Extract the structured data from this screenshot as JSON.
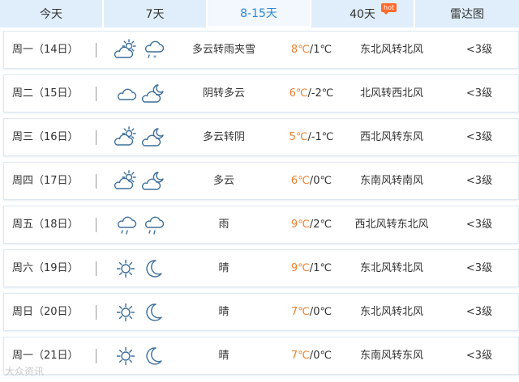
{
  "tabs": [
    {
      "label": "今天"
    },
    {
      "label": "7天"
    },
    {
      "label": "8-15天"
    },
    {
      "label": "40天",
      "badge": "hot"
    },
    {
      "label": "雷达图"
    }
  ],
  "active_tab": "8-15天",
  "accent_color": "#2b8ad8",
  "high_temp_color": "#f0812f",
  "rows": [
    {
      "day": "周一（14日）",
      "icon_day": "partly-cloudy-day-icon",
      "icon_night": "sleet-icon",
      "desc": "多云转雨夹雪",
      "high": "8℃",
      "low": "1℃",
      "wind": "东北风转北风",
      "level": "<3级"
    },
    {
      "day": "周二（15日）",
      "icon_day": "overcast-icon",
      "icon_night": "partly-cloudy-night-icon",
      "desc": "阴转多云",
      "high": "6℃",
      "low": "-2℃",
      "wind": "北风转西北风",
      "level": "<3级"
    },
    {
      "day": "周三（16日）",
      "icon_day": "partly-cloudy-day-icon",
      "icon_night": "partly-cloudy-night-icon",
      "desc": "多云转阴",
      "high": "5℃",
      "low": "-1℃",
      "wind": "西北风转东风",
      "level": "<3级"
    },
    {
      "day": "周四（17日）",
      "icon_day": "partly-cloudy-day-icon",
      "icon_night": "partly-cloudy-night-icon",
      "desc": "多云",
      "high": "6℃",
      "low": "0℃",
      "wind": "东南风转南风",
      "level": "<3级"
    },
    {
      "day": "周五（18日）",
      "icon_day": "rain-icon",
      "icon_night": "rain-icon",
      "desc": "雨",
      "high": "9℃",
      "low": "2℃",
      "wind": "西北风转东北风",
      "level": "<3级"
    },
    {
      "day": "周六（19日）",
      "icon_day": "sunny-icon",
      "icon_night": "moon-icon",
      "desc": "晴",
      "high": "9℃",
      "low": "1℃",
      "wind": "东北风转北风",
      "level": "<3级"
    },
    {
      "day": "周日（20日）",
      "icon_day": "sunny-icon",
      "icon_night": "moon-icon",
      "desc": "晴",
      "high": "7℃",
      "low": "0℃",
      "wind": "东北风转北风",
      "level": "<3级"
    },
    {
      "day": "周一（21日）",
      "icon_day": "sunny-icon",
      "icon_night": "moon-icon",
      "desc": "晴",
      "high": "7℃",
      "low": "0℃",
      "wind": "东南风转东风",
      "level": "<3级"
    }
  ],
  "watermark": "大众资讯"
}
